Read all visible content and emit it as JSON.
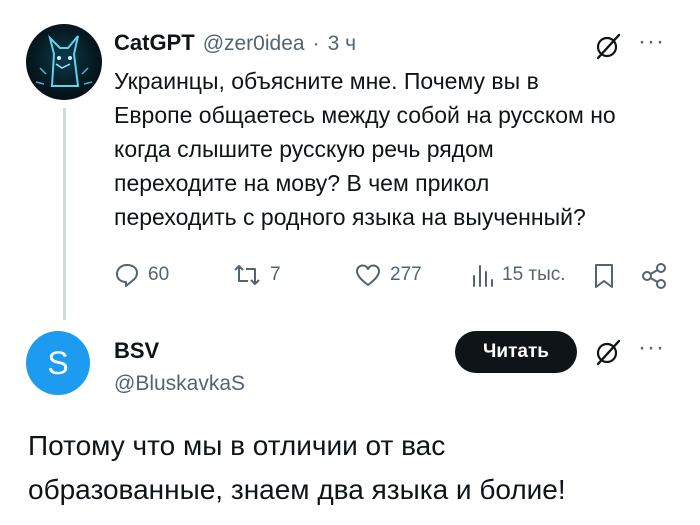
{
  "tweet": {
    "author_name": "CatGPT",
    "handle": "@zer0idea",
    "separator": "·",
    "time": "3 ч",
    "text_lines": [
      "Украинцы, объясните мне. Почему вы в",
      "Европе общаетесь между собой на русском но",
      "когда слышите русскую речь рядом",
      "переходите на мову? В чем прикол",
      "переходить с родного языка на выученный?"
    ],
    "stats": {
      "replies": "60",
      "reposts": "7",
      "likes": "277",
      "views": "15 тыс."
    },
    "more": "···"
  },
  "reply": {
    "avatar_letter": "S",
    "author_name": "BSV",
    "handle": "@BluskavkaS",
    "follow_label": "Читать",
    "more": "···",
    "text_lines": [
      "Потому что мы в отличии от вас",
      "образованные, знаем два языка и болие!"
    ]
  },
  "colors": {
    "text": "#0f1419",
    "secondary": "#536471",
    "avatar_blue": "#1d9bf0",
    "button": "#0f1419"
  }
}
